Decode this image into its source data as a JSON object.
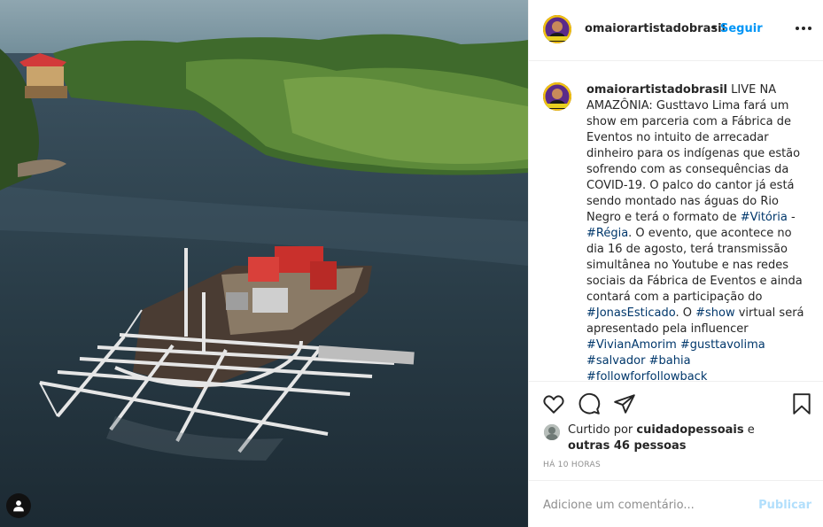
{
  "post": {
    "username": "omaiorartistadobrasil",
    "separator": "•",
    "follow_label": "Seguir",
    "more_icon": "more-horizontal-icon"
  },
  "caption": {
    "username": "omaiorartistadobrasil",
    "text_1": " LIVE NA AMAZÔNIA: Gusttavo Lima fará um show em parceria com a Fábrica de Eventos no intuito de arrecadar dinheiro para os indígenas que estão sofrendo com as consequências da COVID-19. O palco do cantor já está sendo montado nas águas do Rio Negro e terá o formato de ",
    "tag_vitoria": "#Vitória",
    "text_2": " - ",
    "tag_regia": "#Régia",
    "text_3": ". O evento, que acontece no dia 16 de agosto, terá transmissão simultânea no Youtube e nas redes sociais da Fábrica de Eventos e ainda contará com a participação do ",
    "tag_jonas": "#JonasEsticado",
    "text_4": ". O ",
    "tag_show": "#show",
    "text_5": " virtual será apresentado pela influencer ",
    "tag_vivian": "#VivianAmorim",
    "tag_gusttavo": "#gusttavolima",
    "tag_salvador": "#salvador",
    "tag_bahia": "#bahia",
    "tag_follow": "#followforfollowback"
  },
  "actions": {
    "like_icon": "heart-icon",
    "comment_icon": "comment-icon",
    "share_icon": "share-icon",
    "save_icon": "bookmark-icon"
  },
  "likes": {
    "prefix": "Curtido por ",
    "user": "cuidadopessoais",
    "conj": " e",
    "others": "outras 46 pessoas"
  },
  "timestamp": "HÁ 10 HORAS",
  "comment_box": {
    "placeholder": "Adicione um comentário...",
    "publish_label": "Publicar"
  },
  "colors": {
    "link": "#0095f6",
    "hashtag": "#00376b",
    "muted": "#8e8e8e",
    "publish_disabled": "#b2dffc"
  }
}
